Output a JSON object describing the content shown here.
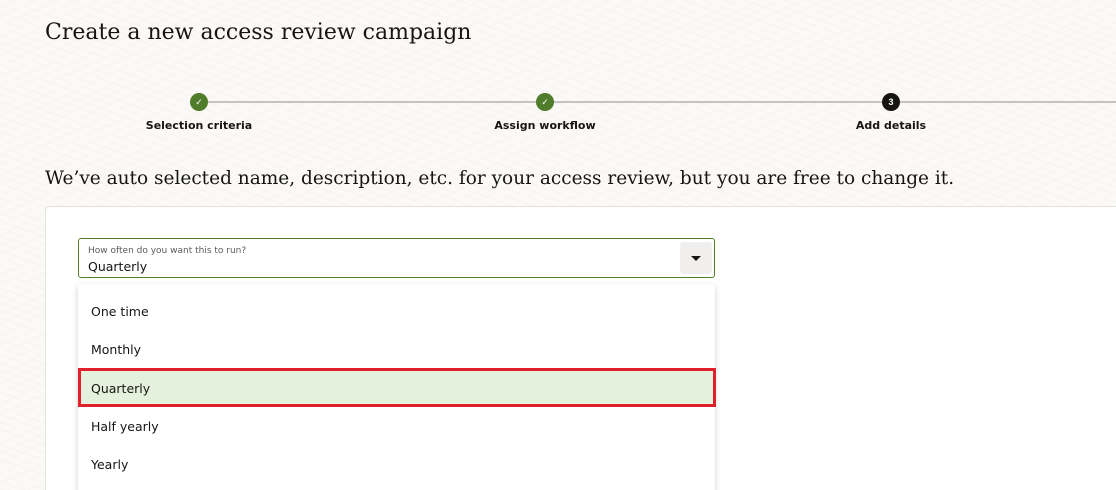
{
  "page": {
    "title": "Create a new access review campaign",
    "subtitle": "We’ve auto selected name, description, etc. for your access review, but you are free to change it."
  },
  "stepper": {
    "steps": [
      {
        "label": "Selection criteria",
        "status": "done",
        "marker": "✓"
      },
      {
        "label": "Assign workflow",
        "status": "done",
        "marker": "✓"
      },
      {
        "label": "Add details",
        "status": "current",
        "marker": "3"
      }
    ]
  },
  "frequency_select": {
    "label": "How often do you want this to run?",
    "value": "Quarterly",
    "options": [
      "One time",
      "Monthly",
      "Quarterly",
      "Half yearly",
      "Yearly"
    ],
    "selected_index": 2
  },
  "colors": {
    "accent_green": "#4f7d2c",
    "selected_bg": "#e4f1dc",
    "highlight_red": "#e0202a"
  },
  "icons": {
    "check": "check-icon",
    "dropdown": "chevron-down-icon"
  }
}
